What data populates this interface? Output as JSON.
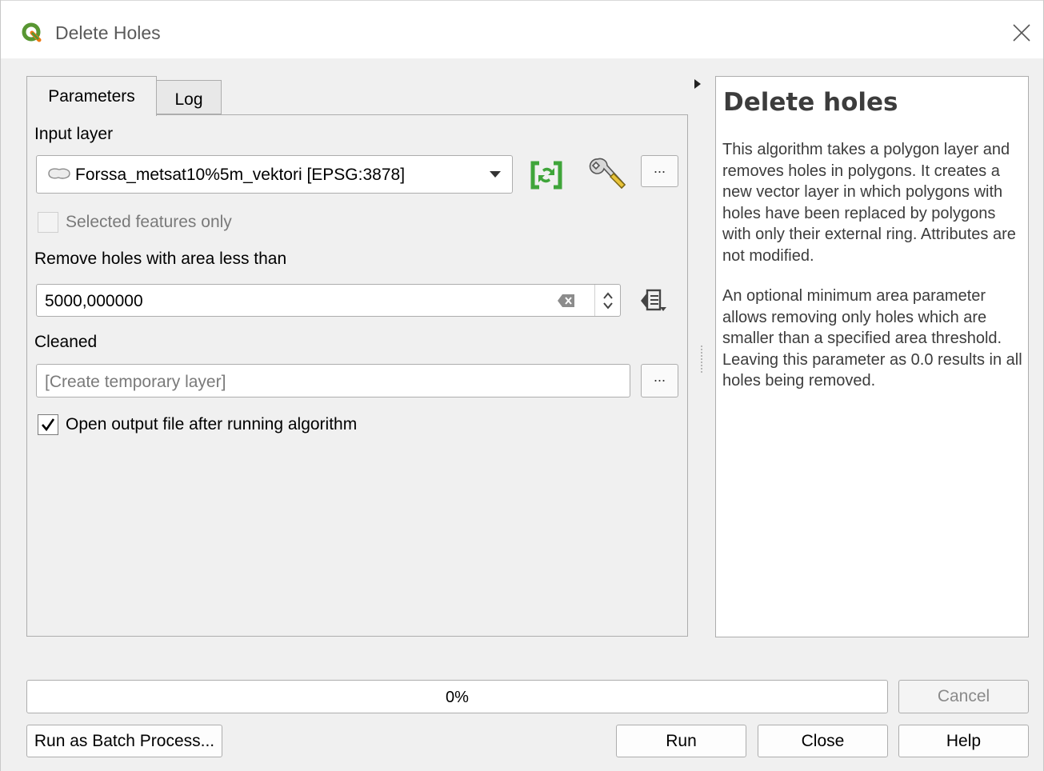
{
  "window": {
    "title": "Delete Holes"
  },
  "tabs": [
    {
      "label": "Parameters",
      "active": true
    },
    {
      "label": "Log",
      "active": false
    }
  ],
  "parameters": {
    "input_layer_label": "Input layer",
    "input_layer_value": "Forssa_metsat10%5m_vektori [EPSG:3878]",
    "more_button": "...",
    "selected_features_label": "Selected features only",
    "selected_features_checked": false,
    "min_area_label": "Remove holes with area less than",
    "min_area_value": "5000,000000",
    "output_label": "Cleaned",
    "output_placeholder": "[Create temporary layer]",
    "open_output_label": "Open output file after running algorithm",
    "open_output_checked": true
  },
  "help": {
    "title": "Delete holes",
    "paragraph1": "This algorithm takes a polygon layer and removes holes in polygons. It creates a new vector layer in which polygons with holes have been replaced by polygons with only their external ring. Attributes are not modified.",
    "paragraph2": "An optional minimum area parameter allows removing only holes which are smaller than a specified area threshold. Leaving this parameter as 0.0 results in all holes being removed."
  },
  "progress": {
    "value": 0,
    "text": "0%"
  },
  "buttons": {
    "cancel": "Cancel",
    "batch": "Run as Batch Process...",
    "run": "Run",
    "close": "Close",
    "help": "Help"
  },
  "icons": {
    "logo": "qgis-logo-icon",
    "close": "close-icon",
    "polygon_layer": "polygon-layer-icon",
    "iterate": "iterate-features-icon",
    "settings": "wrench-icon",
    "dropdown": "chevron-down-icon",
    "clear": "clear-icon",
    "spin": "spin-arrows-icon",
    "data_defined": "data-defined-override-icon",
    "checkmark": "checkmark-icon",
    "collapse": "triangle-right-icon"
  },
  "colors": {
    "qgis_green": "#4e9a3c",
    "iterate_green": "#3fa53a"
  }
}
